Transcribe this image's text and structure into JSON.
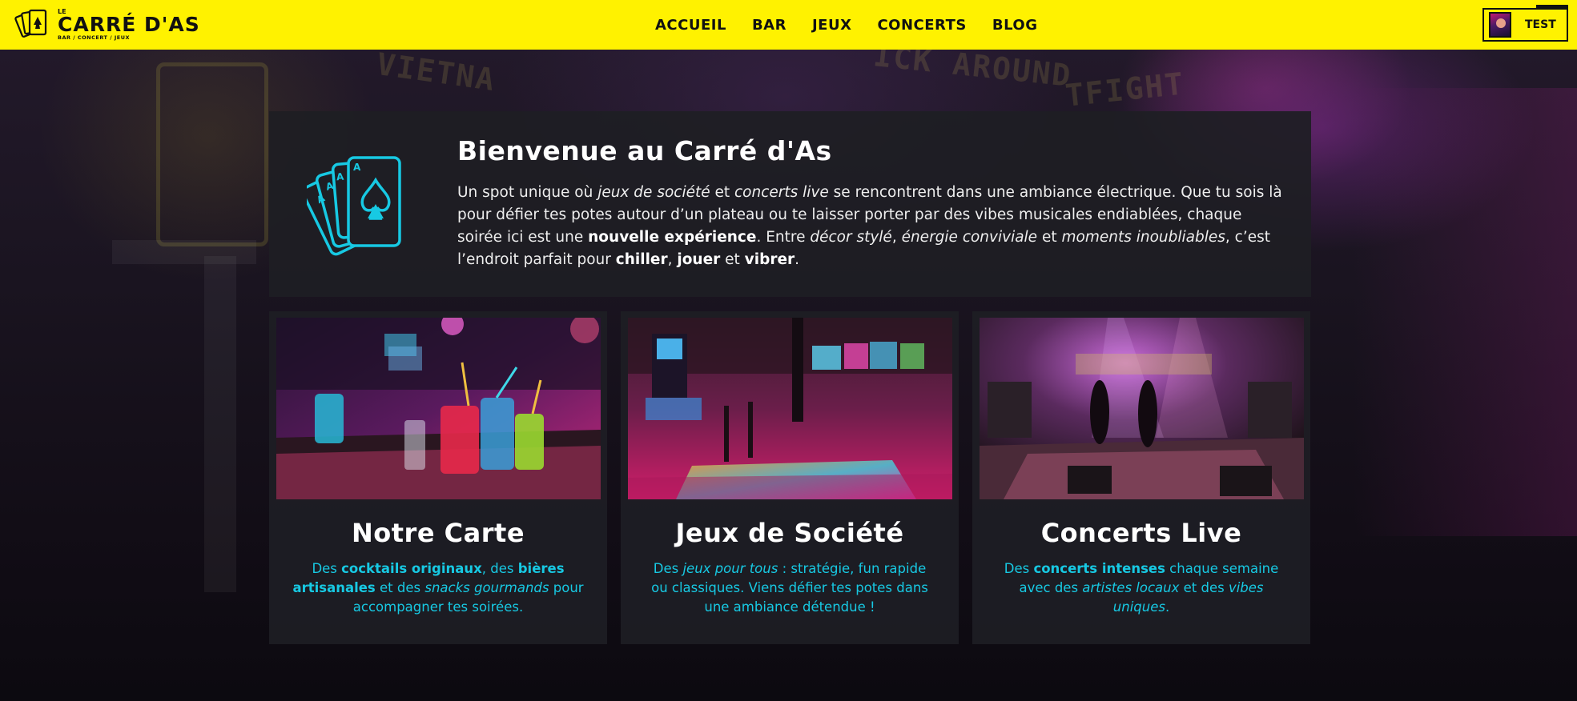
{
  "navbar": {
    "logo": {
      "small": "LE",
      "name": "CARRÉ D'AS",
      "tagline": "BAR / CONCERT / JEUX",
      "icon": "playing-cards-icon"
    },
    "links": [
      "ACCUEIL",
      "BAR",
      "JEUX",
      "CONCERTS",
      "BLOG"
    ],
    "user": {
      "name": "TEST",
      "icon": "avatar"
    },
    "background_color": "#fff200"
  },
  "welcome": {
    "title": "Bienvenue au Carré d'As",
    "icon": "playing-cards-icon",
    "accent_color": "#17c9e3",
    "text": [
      {
        "t": "Un spot unique où "
      },
      {
        "t": "jeux de société",
        "s": "i"
      },
      {
        "t": " et "
      },
      {
        "t": "concerts live",
        "s": "i"
      },
      {
        "t": " se rencontrent dans une ambiance électrique. Que tu sois là pour défier tes potes autour d’un plateau ou te laisser porter par des vibes musicales endiablées, chaque soirée ici est une "
      },
      {
        "t": "nouvelle expérience",
        "s": "b"
      },
      {
        "t": ". Entre "
      },
      {
        "t": "décor stylé",
        "s": "i"
      },
      {
        "t": ", "
      },
      {
        "t": "énergie conviviale",
        "s": "i"
      },
      {
        "t": " et "
      },
      {
        "t": "moments inoubliables",
        "s": "i"
      },
      {
        "t": ", c’est l’endroit parfait pour "
      },
      {
        "t": "chiller",
        "s": "b"
      },
      {
        "t": ", "
      },
      {
        "t": "jouer",
        "s": "b"
      },
      {
        "t": " et "
      },
      {
        "t": "vibrer",
        "s": "b"
      },
      {
        "t": "."
      }
    ]
  },
  "cards": [
    {
      "title": "Notre Carte",
      "image": "bar-cocktails-image",
      "text": [
        {
          "t": "Des "
        },
        {
          "t": "cocktails originaux",
          "s": "b"
        },
        {
          "t": ", des "
        },
        {
          "t": "bières artisanales",
          "s": "b"
        },
        {
          "t": " et des "
        },
        {
          "t": "snacks gourmands",
          "s": "i"
        },
        {
          "t": " pour accompagner tes soirées."
        }
      ]
    },
    {
      "title": "Jeux de Société",
      "image": "arcade-game-room-image",
      "text": [
        {
          "t": "Des "
        },
        {
          "t": "jeux pour tous",
          "s": "i"
        },
        {
          "t": " : stratégie, fun rapide ou classiques. Viens défier tes potes dans une ambiance détendue !"
        }
      ]
    },
    {
      "title": "Concerts Live",
      "image": "concert-stage-image",
      "text": [
        {
          "t": "Des "
        },
        {
          "t": "concerts intenses",
          "s": "b"
        },
        {
          "t": " chaque semaine avec des "
        },
        {
          "t": "artistes locaux",
          "s": "i"
        },
        {
          "t": " et des "
        },
        {
          "t": "vibes uniques",
          "s": "i"
        },
        {
          "t": "."
        }
      ]
    }
  ]
}
